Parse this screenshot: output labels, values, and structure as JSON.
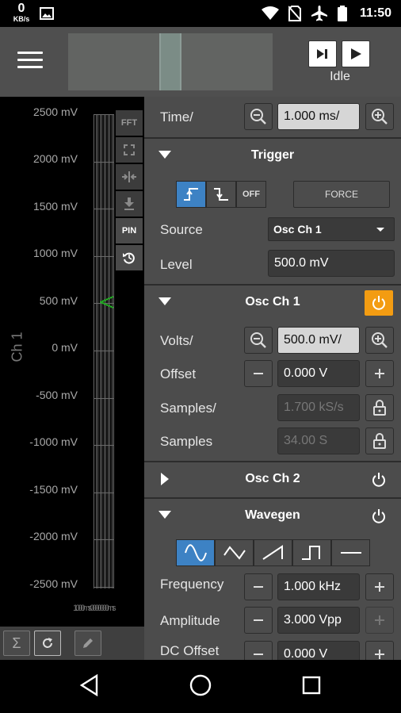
{
  "status": {
    "net_speed": "0",
    "net_unit": "KB/s",
    "time": "11:50"
  },
  "toolbar": {
    "run_status": "Idle",
    "icons": [
      "menu-icon",
      "step-icon",
      "play-icon"
    ]
  },
  "plot": {
    "y_labels": [
      "2500 mV",
      "2000 mV",
      "1500 mV",
      "1000 mV",
      "500 mV",
      "0 mV",
      "-500 mV",
      "-1000 mV",
      "-1500 mV",
      "-2000 mV",
      "-2500 mV"
    ],
    "channel_label": "Ch 1",
    "x_labels_overlap": "1.000ms0000000ms",
    "tools": {
      "fft": "FFT",
      "pin": "PIN"
    },
    "trigger_marker_color": "#22aa22"
  },
  "time": {
    "label": "Time/",
    "value": "1.000 ms/"
  },
  "trigger": {
    "title": "Trigger",
    "off_label": "OFF",
    "force_label": "FORCE",
    "source_label": "Source",
    "source_value": "Osc Ch 1",
    "level_label": "Level",
    "level_value": "500.0 mV"
  },
  "osc1": {
    "title": "Osc Ch 1",
    "volts_label": "Volts/",
    "volts_value": "500.0 mV/",
    "offset_label": "Offset",
    "offset_value": "0.000 V",
    "samples_rate_label": "Samples/",
    "samples_rate_value": "1.700 kS/s",
    "samples_label": "Samples",
    "samples_value": "34.00 S",
    "power_color": "#f39c12"
  },
  "osc2": {
    "title": "Osc Ch 2"
  },
  "wavegen": {
    "title": "Wavegen",
    "frequency_label": "Frequency",
    "frequency_value": "1.000 kHz",
    "amplitude_label": "Amplitude",
    "amplitude_value": "3.000 Vpp",
    "dc_offset_label": "DC Offset",
    "dc_offset_value": "0.000 V",
    "selected_color": "#3d82c4"
  }
}
